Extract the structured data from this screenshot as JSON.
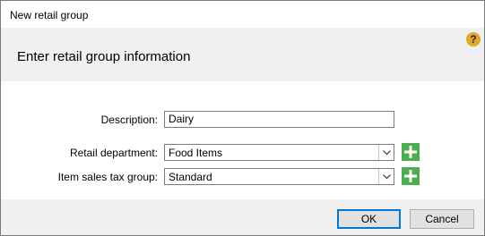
{
  "window": {
    "title": "New retail group"
  },
  "header": {
    "text": "Enter retail group information",
    "help_icon": "?"
  },
  "form": {
    "description": {
      "label": "Description:",
      "value": "Dairy"
    },
    "retail_department": {
      "label": "Retail department:",
      "value": "Food Items"
    },
    "item_sales_tax_group": {
      "label": "Item sales tax group:",
      "value": "Standard"
    }
  },
  "footer": {
    "ok_label": "OK",
    "cancel_label": "Cancel"
  },
  "colors": {
    "add_button": "#4cae4f",
    "help_icon": "#e2a52e",
    "default_button_border": "#0078d7"
  }
}
